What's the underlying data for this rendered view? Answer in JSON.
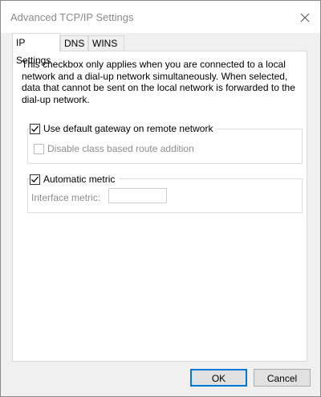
{
  "window": {
    "title": "Advanced TCP/IP Settings",
    "close_icon": "close-icon"
  },
  "tabs": [
    {
      "label": "IP Settings",
      "active": true
    },
    {
      "label": "DNS",
      "active": false
    },
    {
      "label": "WINS",
      "active": false
    }
  ],
  "panel": {
    "description": "This checkbox only applies when you are connected to a local network and a dial-up network simultaneously. When selected, data that cannot be sent on the local network is forwarded to the dial-up network.",
    "use_default_gateway": {
      "label": "Use default gateway on remote network",
      "checked": true
    },
    "disable_class_route": {
      "label": "Disable class based route addition",
      "checked": false,
      "enabled": false
    },
    "automatic_metric": {
      "label": "Automatic metric",
      "checked": true
    },
    "interface_metric": {
      "label": "Interface metric:",
      "value": ""
    }
  },
  "buttons": {
    "ok": "OK",
    "cancel": "Cancel"
  },
  "colors": {
    "accent": "#0078d7",
    "disabled_text": "#8d8d8d",
    "dialog_bg": "#f0f0f0"
  }
}
